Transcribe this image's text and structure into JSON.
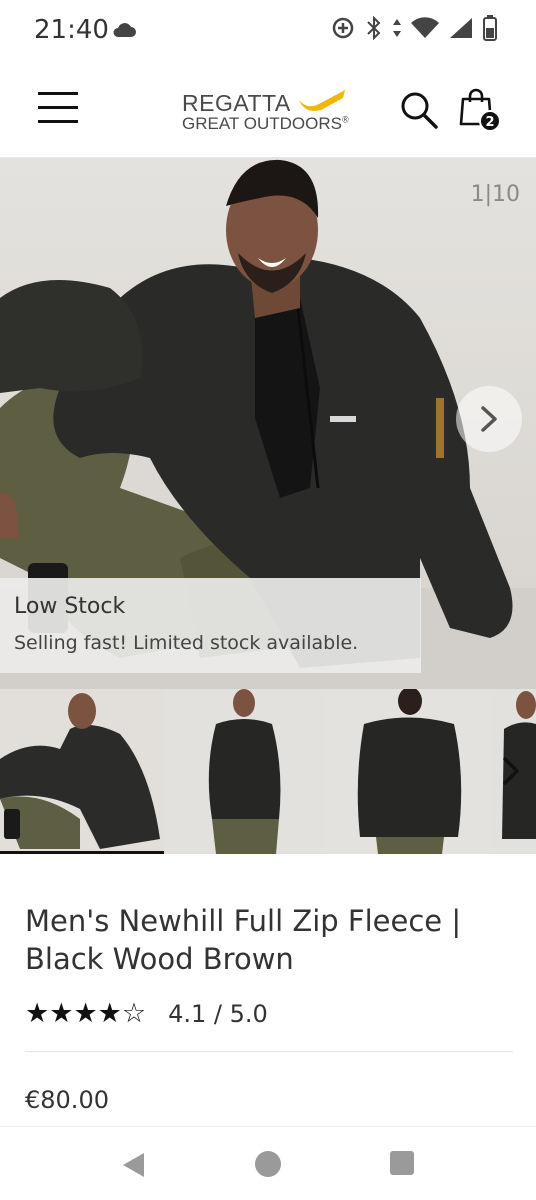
{
  "status_bar": {
    "time": "21:40"
  },
  "header": {
    "logo_top": "REGATTA",
    "logo_bottom": "GREAT OUTDOORS",
    "logo_trademark": "®",
    "cart_count": "2",
    "icons": [
      "menu-icon",
      "search-icon",
      "shopping-bag-icon"
    ],
    "brand_accent": "#f2b705"
  },
  "gallery": {
    "counter": "1|10",
    "stock_title": "Low Stock",
    "stock_message": "Selling fast! Limited stock available.",
    "thumbnail_count": 4
  },
  "product": {
    "title": "Men's Newhill Full Zip Fleece | Black Wood Brown",
    "rating_stars": 4.1,
    "rating_text": "4.1 / 5.0",
    "price": "€80.00"
  },
  "nav_bar": {
    "icons": [
      "back-icon",
      "home-icon",
      "recents-icon"
    ]
  }
}
